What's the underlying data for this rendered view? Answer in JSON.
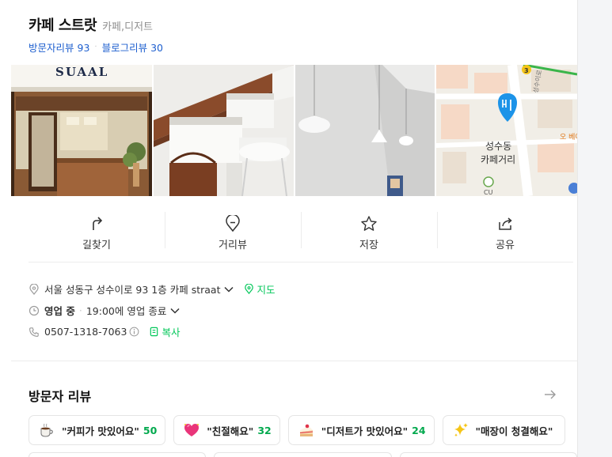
{
  "place": {
    "name": "카페 스트랏",
    "category": "카페,디저트",
    "visitor_reviews_label": "방문자리뷰",
    "visitor_reviews_count": "93",
    "blog_reviews_label": "블로그리뷰",
    "blog_reviews_count": "30"
  },
  "photos": {
    "storefront_sign": "SUAAL",
    "map_label_line1": "성수동",
    "map_label_line2": "카페거리",
    "map_road_label": "성수이로",
    "map_route_number": "3",
    "map_side_label": "오 베이",
    "map_bottom_label": "CU"
  },
  "actions": [
    {
      "label": "길찾기",
      "icon": "directions-icon"
    },
    {
      "label": "거리뷰",
      "icon": "street-view-icon"
    },
    {
      "label": "저장",
      "icon": "star-icon"
    },
    {
      "label": "공유",
      "icon": "share-icon"
    }
  ],
  "info": {
    "address": "서울 성동구 성수이로 93 1층 카페 straat",
    "map_link": "지도",
    "status": "영업 중",
    "hours": "19:00에 영업 종료",
    "phone": "0507-1318-7063",
    "copy": "복사"
  },
  "visitor_review_section": {
    "title": "방문자 리뷰",
    "chips": [
      {
        "text": "\"커피가 맛있어요\"",
        "count": "50",
        "icon": "coffee-icon"
      },
      {
        "text": "\"친절해요\"",
        "count": "32",
        "icon": "heart-icon"
      },
      {
        "text": "\"디저트가 맛있어요\"",
        "count": "24",
        "icon": "cake-icon"
      },
      {
        "text": "\"매장이 청결해요\"",
        "count": "",
        "icon": "sparkle-icon"
      }
    ]
  },
  "colors": {
    "link_blue": "#1e5fcf",
    "naver_green": "#03c75a",
    "map_pin_blue": "#1c93e8"
  }
}
